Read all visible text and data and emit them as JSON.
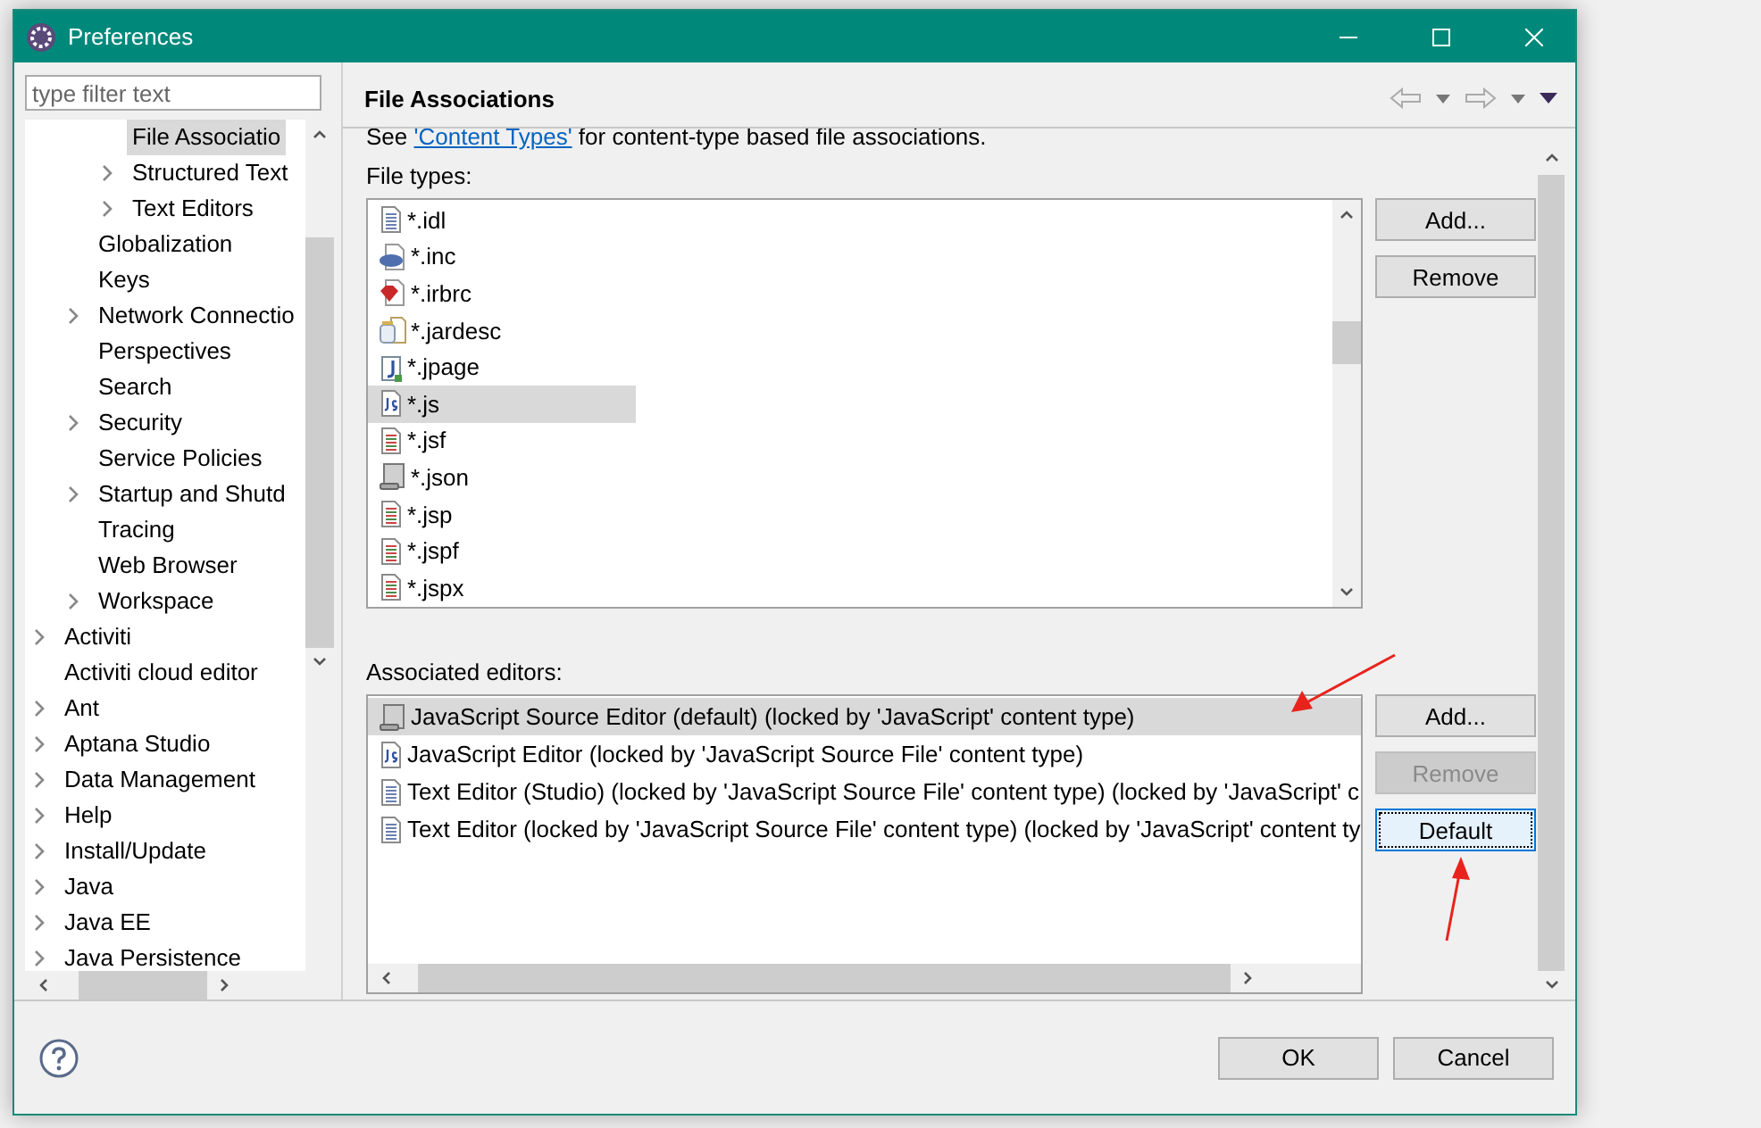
{
  "window": {
    "title": "Preferences"
  },
  "filter": {
    "placeholder": "type filter text"
  },
  "tree": [
    {
      "children": [
        {
          "children": [
            {
              "label": "File Associatio",
              "expandable": false,
              "selected": true
            },
            {
              "label": "Structured Text",
              "expandable": true,
              "selected": false
            },
            {
              "label": "Text Editors",
              "expandable": true,
              "selected": false
            }
          ]
        },
        {
          "label": "Globalization",
          "expandable": false,
          "selected": false
        },
        {
          "label": "Keys",
          "expandable": false,
          "selected": false
        },
        {
          "label": "Network Connectio",
          "expandable": true,
          "selected": false
        },
        {
          "label": "Perspectives",
          "expandable": false,
          "selected": false
        },
        {
          "label": "Search",
          "expandable": false,
          "selected": false
        },
        {
          "label": "Security",
          "expandable": true,
          "selected": false
        },
        {
          "label": "Service Policies",
          "expandable": false,
          "selected": false
        },
        {
          "label": "Startup and Shutd",
          "expandable": true,
          "selected": false
        },
        {
          "label": "Tracing",
          "expandable": false,
          "selected": false
        },
        {
          "label": "Web Browser",
          "expandable": false,
          "selected": false
        },
        {
          "label": "Workspace",
          "expandable": true,
          "selected": false
        }
      ]
    },
    {
      "label": "Activiti",
      "expandable": true,
      "selected": false
    },
    {
      "label": "Activiti cloud editor",
      "expandable": false,
      "selected": false
    },
    {
      "label": "Ant",
      "expandable": true,
      "selected": false
    },
    {
      "label": "Aptana Studio",
      "expandable": true,
      "selected": false
    },
    {
      "label": "Data Management",
      "expandable": true,
      "selected": false
    },
    {
      "label": "Help",
      "expandable": true,
      "selected": false
    },
    {
      "label": "Install/Update",
      "expandable": true,
      "selected": false
    },
    {
      "label": "Java",
      "expandable": true,
      "selected": false
    },
    {
      "label": "Java EE",
      "expandable": true,
      "selected": false
    },
    {
      "label": "Java Persistence",
      "expandable": true,
      "selected": false
    }
  ],
  "page": {
    "title": "File Associations",
    "description": {
      "before": "See ",
      "link": "'Content Types'",
      "after": " for content-type based file associations."
    },
    "file_types_label": "File types:",
    "file_types": [
      {
        "label": "*.idl",
        "kind": "text",
        "selected": false
      },
      {
        "label": "*.inc",
        "kind": "php",
        "selected": false
      },
      {
        "label": "*.irbrc",
        "kind": "ruby",
        "selected": false
      },
      {
        "label": "*.jardesc",
        "kind": "jar",
        "selected": false
      },
      {
        "label": "*.jpage",
        "kind": "java",
        "selected": false
      },
      {
        "label": "*.js",
        "kind": "script",
        "selected": true
      },
      {
        "label": "*.jsf",
        "kind": "page",
        "selected": false
      },
      {
        "label": "*.json",
        "kind": "scroll",
        "selected": false
      },
      {
        "label": "*.jsp",
        "kind": "page",
        "selected": false
      },
      {
        "label": "*.jspf",
        "kind": "page",
        "selected": false
      },
      {
        "label": "*.jspx",
        "kind": "page",
        "selected": false
      }
    ],
    "file_type_buttons": [
      {
        "label": "Add...",
        "disabled": false,
        "focused": false
      },
      {
        "label": "Remove",
        "disabled": false,
        "focused": false
      }
    ],
    "editors_label": "Associated editors:",
    "editors": [
      {
        "label": "JavaScript Source Editor (default) (locked by 'JavaScript' content type)",
        "kind": "scroll",
        "selected": true
      },
      {
        "label": "JavaScript Editor (locked by 'JavaScript Source File' content type)",
        "kind": "script",
        "selected": false
      },
      {
        "label": "Text Editor (Studio) (locked by 'JavaScript Source File' content type) (locked by 'JavaScript' c",
        "kind": "lines",
        "selected": false
      },
      {
        "label": "Text Editor (locked by 'JavaScript Source File' content type) (locked by 'JavaScript' content ty",
        "kind": "text",
        "selected": false
      }
    ],
    "editor_buttons": [
      {
        "label": "Add...",
        "disabled": false,
        "focused": false
      },
      {
        "label": "Remove",
        "disabled": true,
        "focused": false
      },
      {
        "label": "Default",
        "disabled": false,
        "focused": true
      }
    ]
  },
  "buttons": [
    {
      "label": "OK"
    },
    {
      "label": "Cancel"
    }
  ]
}
